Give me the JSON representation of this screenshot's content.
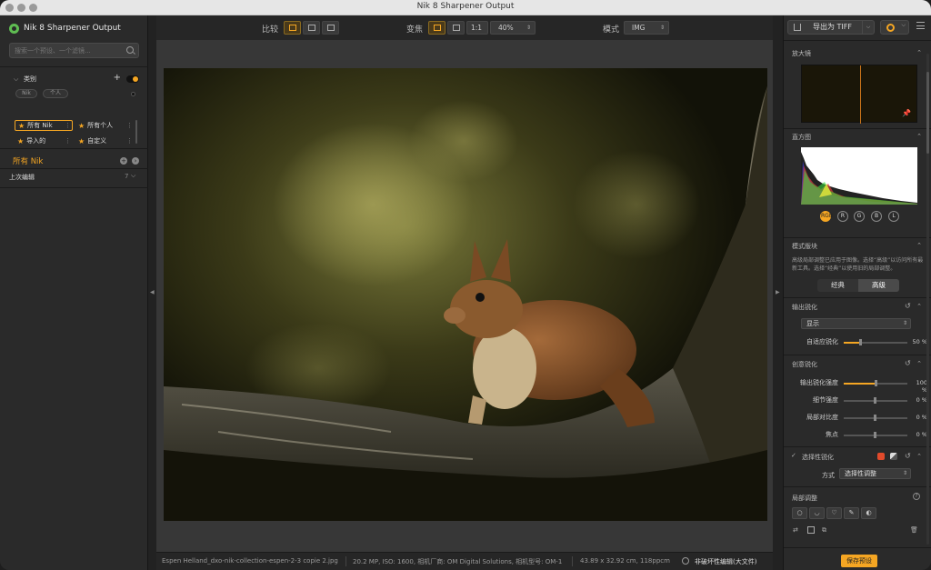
{
  "window": {
    "title": "Nik 8 Sharpener Output"
  },
  "left": {
    "brand": "Nik 8 Sharpener Output",
    "search_placeholder": "搜索一个预设、一个滤镜...",
    "category_title": "类别",
    "pills": [
      "Nik",
      "个人"
    ],
    "presets": [
      {
        "label": "所有 Nik",
        "active": true
      },
      {
        "label": "所有个人",
        "active": false
      },
      {
        "label": "导入的",
        "active": false
      },
      {
        "label": "自定义",
        "active": false
      }
    ],
    "all_nik": "所有 Nik",
    "last_edit_label": "上次编辑",
    "last_edit_count": "7"
  },
  "toolbar": {
    "compare_label": "比较",
    "zoom_label": "变焦",
    "zoom_one": "1:1",
    "zoom_value": "40%",
    "mode_label": "模式",
    "mode_value": "IMG"
  },
  "status": {
    "filename": "Espen Helland_dxo-nik-collection-espen-2-3 copie 2.jpg",
    "info": "20.2 MP, ISO: 1600, 相机厂商: OM Digital Solutions, 相机型号: OM-1",
    "dims": "43.89 x 32.92 cm, 118ppcm",
    "nondestructive": "非破坏性编辑(大文件)"
  },
  "right": {
    "export_label": "导出为 TIFF",
    "loupe_title": "放大镜",
    "histogram_title": "直方图",
    "channels": [
      "RGB",
      "R",
      "G",
      "B",
      "L"
    ],
    "mode_title": "模式版块",
    "mode_desc": "高级局部调整已应用于图像。选择“高级”以访问所有最新工具。选择“经典”以使用旧的局部调整。",
    "mode_classic": "经典",
    "mode_advanced": "高级",
    "output_title": "输出锐化",
    "output_select": "显示",
    "adaptive_label": "自适应锐化",
    "adaptive_value": "50 %",
    "adaptive_level": 50,
    "creative_title": "创意锐化",
    "sliders": [
      {
        "label": "输出锐化强度",
        "value": "100 %",
        "level": 100
      },
      {
        "label": "细节强度",
        "value": "0 %",
        "level": 0
      },
      {
        "label": "局部对比度",
        "value": "0 %",
        "level": 0
      },
      {
        "label": "焦点",
        "value": "0 %",
        "level": 0
      }
    ],
    "selective_title": "选择性锐化",
    "method_label": "方式",
    "method_value": "选择性调整",
    "local_title": "局部调整",
    "save_label": "保存预设",
    "colors": {
      "accent": "#f5a623",
      "red": "#e14a2b"
    }
  }
}
